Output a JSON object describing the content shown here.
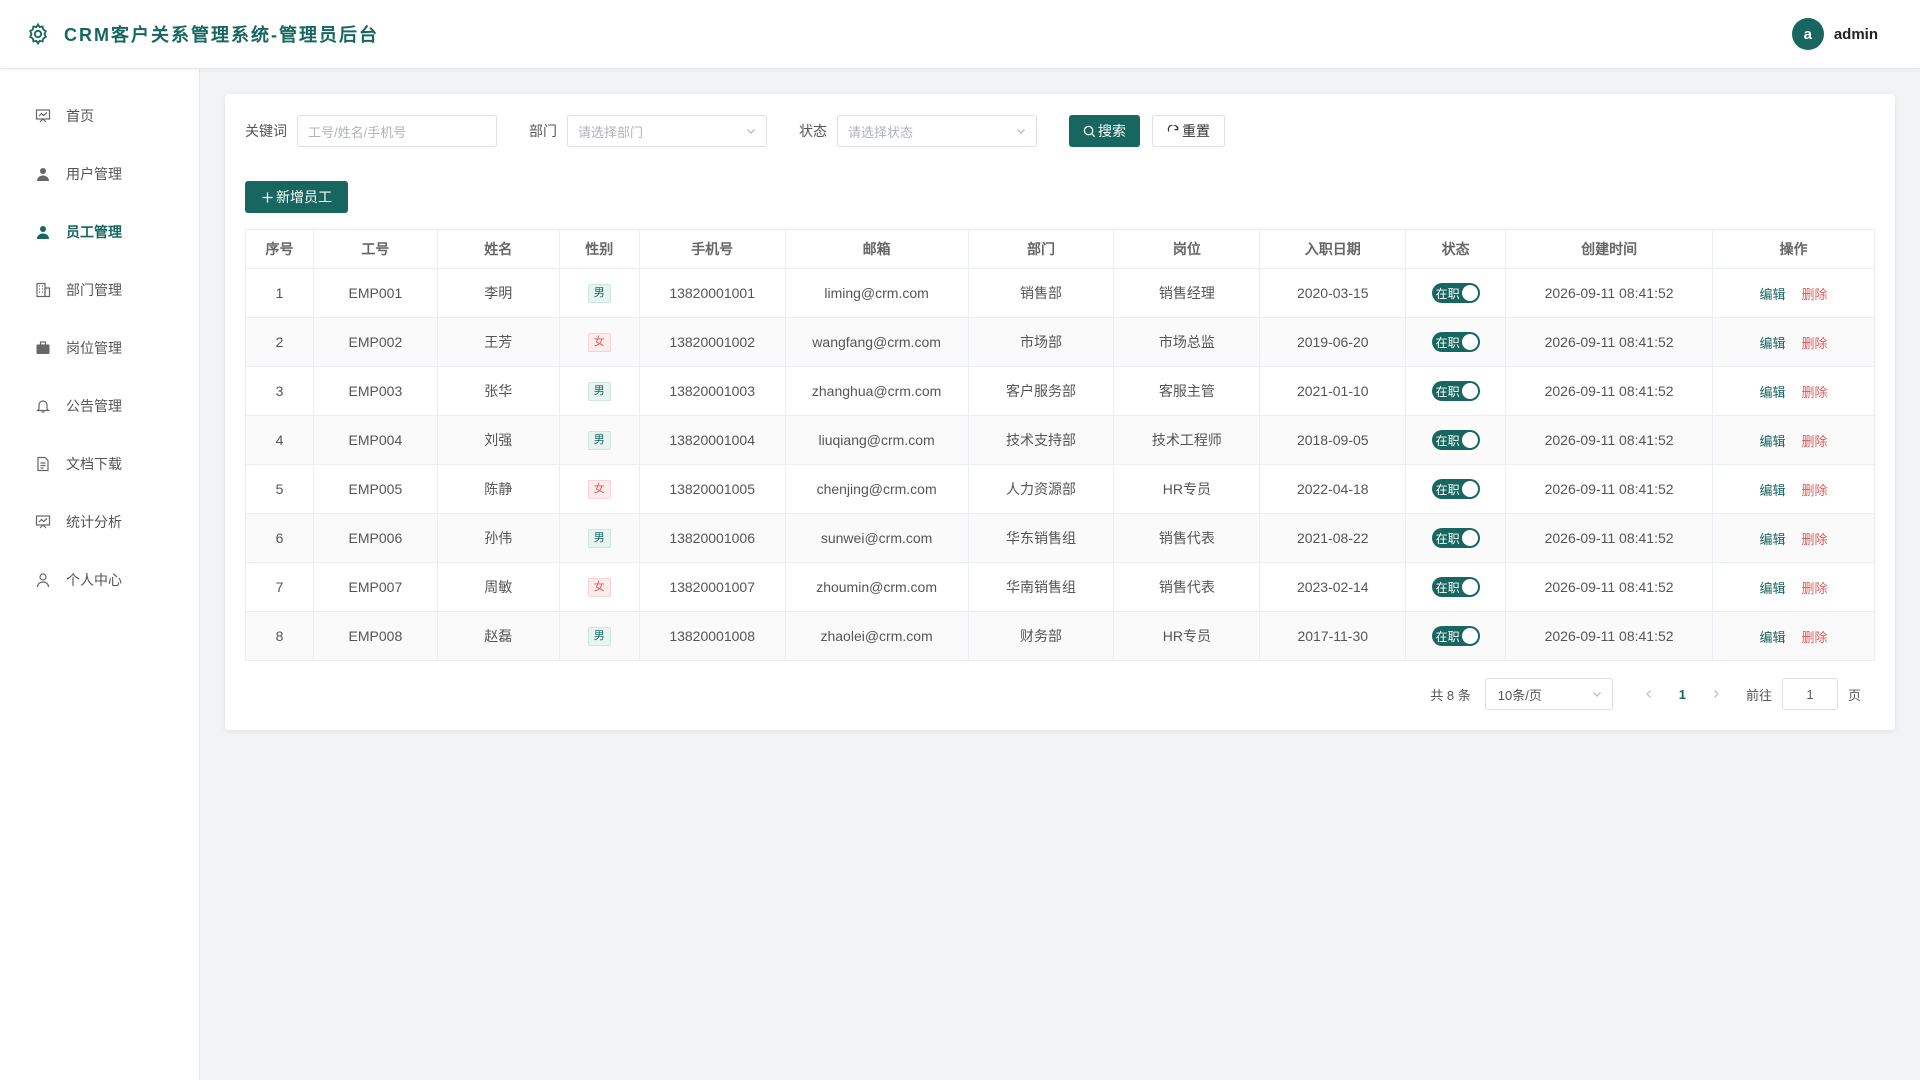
{
  "app": {
    "title": "CRM客户关系管理系统-管理员后台"
  },
  "user": {
    "avatar_letter": "a",
    "name": "admin"
  },
  "colors": {
    "primary": "#17665f",
    "danger": "#e05a5a"
  },
  "sidebar": {
    "items": [
      {
        "label": "首页",
        "icon": "chart-board-icon"
      },
      {
        "label": "用户管理",
        "icon": "user-icon"
      },
      {
        "label": "员工管理",
        "icon": "user-icon",
        "active": true
      },
      {
        "label": "部门管理",
        "icon": "building-icon"
      },
      {
        "label": "岗位管理",
        "icon": "briefcase-icon"
      },
      {
        "label": "公告管理",
        "icon": "bell-icon"
      },
      {
        "label": "文档下载",
        "icon": "document-icon"
      },
      {
        "label": "统计分析",
        "icon": "chart-board-icon"
      },
      {
        "label": "个人中心",
        "icon": "user-outline-icon"
      }
    ]
  },
  "filters": {
    "keyword_label": "关键词",
    "keyword_placeholder": "工号/姓名/手机号",
    "dept_label": "部门",
    "dept_placeholder": "请选择部门",
    "status_label": "状态",
    "status_placeholder": "请选择状态",
    "search_label": "搜索",
    "reset_label": "重置"
  },
  "add_button": "新增员工",
  "table": {
    "headers": [
      "序号",
      "工号",
      "姓名",
      "性别",
      "手机号",
      "邮箱",
      "部门",
      "岗位",
      "入职日期",
      "状态",
      "创建时间",
      "操作"
    ],
    "edit_label": "编辑",
    "delete_label": "删除",
    "rows": [
      {
        "no": "1",
        "emp_id": "EMP001",
        "name": "李明",
        "gender": "男",
        "phone": "13820001001",
        "email": "liming@crm.com",
        "dept": "销售部",
        "post": "销售经理",
        "hire_date": "2020-03-15",
        "status": "在职",
        "created": "2026-09-11 08:41:52"
      },
      {
        "no": "2",
        "emp_id": "EMP002",
        "name": "王芳",
        "gender": "女",
        "phone": "13820001002",
        "email": "wangfang@crm.com",
        "dept": "市场部",
        "post": "市场总监",
        "hire_date": "2019-06-20",
        "status": "在职",
        "created": "2026-09-11 08:41:52"
      },
      {
        "no": "3",
        "emp_id": "EMP003",
        "name": "张华",
        "gender": "男",
        "phone": "13820001003",
        "email": "zhanghua@crm.com",
        "dept": "客户服务部",
        "post": "客服主管",
        "hire_date": "2021-01-10",
        "status": "在职",
        "created": "2026-09-11 08:41:52"
      },
      {
        "no": "4",
        "emp_id": "EMP004",
        "name": "刘强",
        "gender": "男",
        "phone": "13820001004",
        "email": "liuqiang@crm.com",
        "dept": "技术支持部",
        "post": "技术工程师",
        "hire_date": "2018-09-05",
        "status": "在职",
        "created": "2026-09-11 08:41:52"
      },
      {
        "no": "5",
        "emp_id": "EMP005",
        "name": "陈静",
        "gender": "女",
        "phone": "13820001005",
        "email": "chenjing@crm.com",
        "dept": "人力资源部",
        "post": "HR专员",
        "hire_date": "2022-04-18",
        "status": "在职",
        "created": "2026-09-11 08:41:52"
      },
      {
        "no": "6",
        "emp_id": "EMP006",
        "name": "孙伟",
        "gender": "男",
        "phone": "13820001006",
        "email": "sunwei@crm.com",
        "dept": "华东销售组",
        "post": "销售代表",
        "hire_date": "2021-08-22",
        "status": "在职",
        "created": "2026-09-11 08:41:52"
      },
      {
        "no": "7",
        "emp_id": "EMP007",
        "name": "周敏",
        "gender": "女",
        "phone": "13820001007",
        "email": "zhoumin@crm.com",
        "dept": "华南销售组",
        "post": "销售代表",
        "hire_date": "2023-02-14",
        "status": "在职",
        "created": "2026-09-11 08:41:52"
      },
      {
        "no": "8",
        "emp_id": "EMP008",
        "name": "赵磊",
        "gender": "男",
        "phone": "13820001008",
        "email": "zhaolei@crm.com",
        "dept": "财务部",
        "post": "HR专员",
        "hire_date": "2017-11-30",
        "status": "在职",
        "created": "2026-09-11 08:41:52"
      }
    ]
  },
  "pagination": {
    "total_text": "共 8 条",
    "page_size": "10条/页",
    "current_page": "1",
    "goto_label": "前往",
    "goto_value": "1",
    "page_suffix": "页"
  }
}
